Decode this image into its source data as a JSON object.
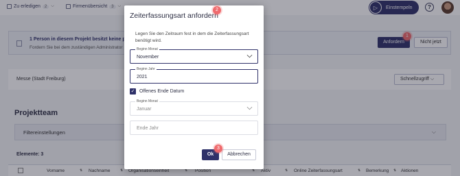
{
  "topbar": {
    "zu_erledigen": {
      "label": "Zu erledigen",
      "count": "2"
    },
    "firmen": {
      "label": "Firmenübersicht",
      "count": "3"
    },
    "stempel_label": "Einstempeln",
    "help": "?"
  },
  "banner": {
    "title": "1 Person in diesem Projekt besitzt keine passe",
    "subtitle": "Fordern Sie bei dem zuständigen Administrator",
    "anfordern": "Anfordern",
    "nicht_jetzt": "Nicht jetzt"
  },
  "messe": {
    "text": "Messe (Stadt Freiburg)",
    "schnellzugriff": "Schnellzugriff"
  },
  "section_title": "Projektteam",
  "filter_label": "Filtereinstellungen",
  "elemente": "Elemente: 3",
  "table_headers": [
    "Vorname",
    "Nachname",
    "Organisationseinheit",
    "Position",
    "Aktiv",
    "Online Zeiterfassungsart",
    "Bemerkung",
    "Aktionen"
  ],
  "modal": {
    "title": "Zeiterfassungsart anfordern",
    "description": "Legen Sie den Zeitraum fest in dem die Zeiterfassungsart benötigt wird.",
    "begin_monat": {
      "label": "Beginn Monat",
      "value": "November"
    },
    "begin_jahr": {
      "label": "Beginn Jahr",
      "value": "2021"
    },
    "offenes_ende": {
      "label": "Offenes Ende Datum",
      "checked": true
    },
    "ende_monat": {
      "label": "Beginn Monat",
      "value": "Januar"
    },
    "ende_jahr": {
      "placeholder": "Ende Jahr"
    },
    "ok": "Ok",
    "abbrechen": "Abbrechen"
  },
  "markers": {
    "m1": "1",
    "m2": "2",
    "m3": "3"
  },
  "colors": {
    "primary": "#2f3169",
    "marker": "#ef6a6d"
  }
}
